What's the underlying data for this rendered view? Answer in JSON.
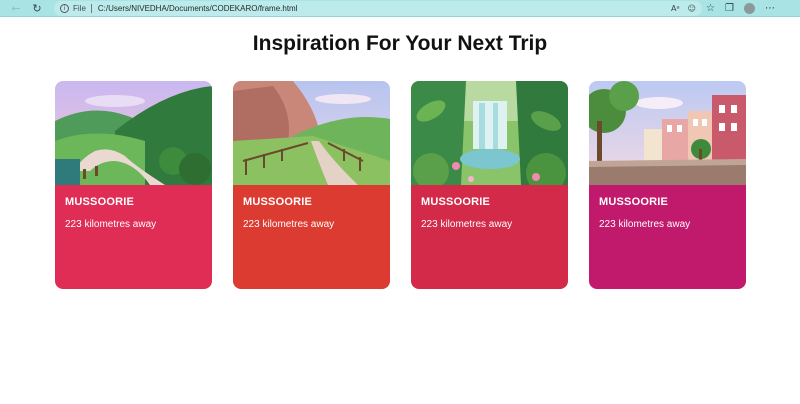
{
  "browser": {
    "address_file_label": "File",
    "address_url": "C:/Users/NIVEDHA/Documents/CODEKARO/frame.html"
  },
  "page": {
    "title": "Inspiration For Your Next Trip"
  },
  "cards": [
    {
      "name": "MUSSOORIE",
      "distance": "223 kilometres away",
      "color": "#e02d55"
    },
    {
      "name": "MUSSOORIE",
      "distance": "223 kilometres away",
      "color": "#dc3b32"
    },
    {
      "name": "MUSSOORIE",
      "distance": "223 kilometres away",
      "color": "#d32a4a"
    },
    {
      "name": "MUSSOORIE",
      "distance": "223 kilometres away",
      "color": "#c11a6c"
    }
  ]
}
